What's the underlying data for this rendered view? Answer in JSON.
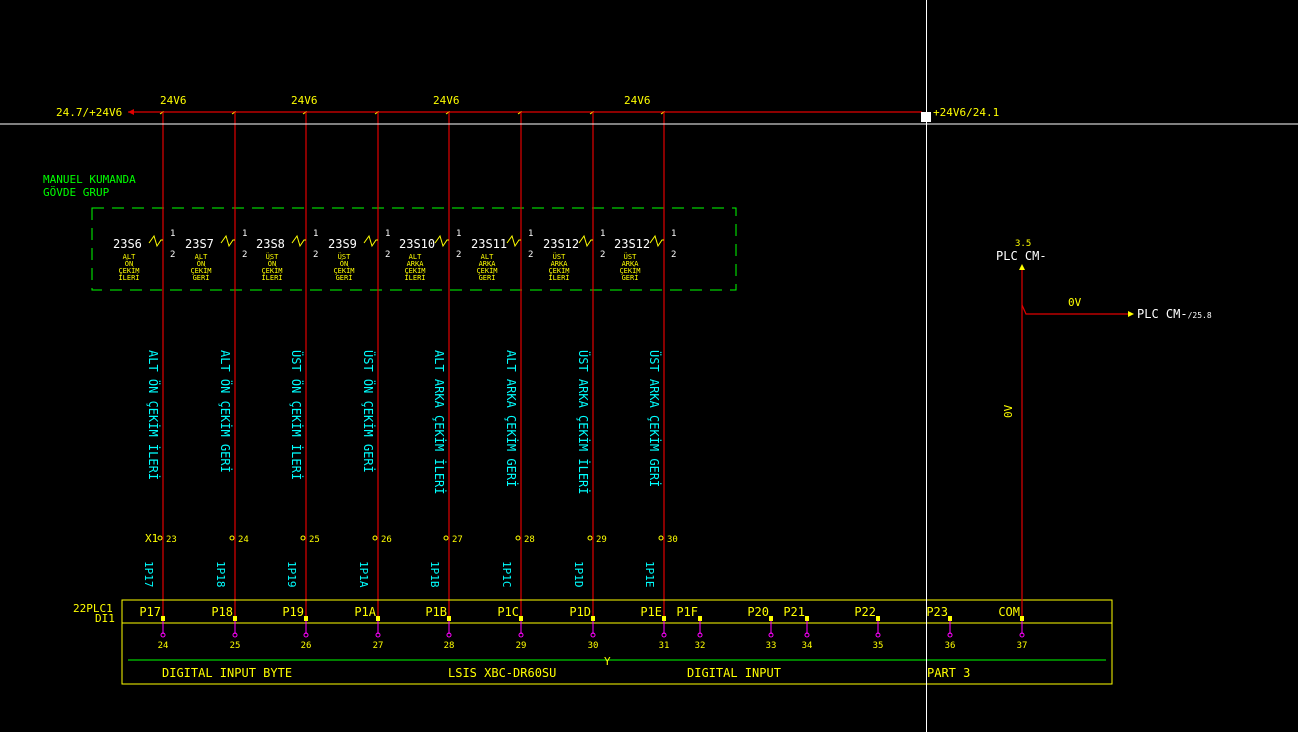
{
  "colors": {
    "background": "#000000",
    "wire": "#e00000",
    "text": "#ffffff",
    "yellow": "#ffff00",
    "green": "#00ff00",
    "cyan": "#00ffff",
    "magenta": "#ff00ff",
    "crosshair": "#ffffff"
  },
  "supply": {
    "left_label": "24.7/+24V6",
    "right_label": "+24V6/24.1",
    "bus_labels": [
      "24V6",
      "24V6",
      "24V6",
      "24V6"
    ]
  },
  "group": {
    "title_line1": "MANUEL KUMANDA",
    "title_line2": "GÖVDE GRUP"
  },
  "switches": [
    {
      "tag": "23S6",
      "pin_top": "1",
      "pin_bot": "2",
      "desc": [
        "ALT",
        "ÖN",
        "ÇEKİM",
        "İLERİ"
      ]
    },
    {
      "tag": "23S7",
      "pin_top": "1",
      "pin_bot": "2",
      "desc": [
        "ALT",
        "ÖN",
        "ÇEKİM",
        "GERİ"
      ]
    },
    {
      "tag": "23S8",
      "pin_top": "1",
      "pin_bot": "2",
      "desc": [
        "ÜST",
        "ÖN",
        "ÇEKİM",
        "İLERİ"
      ]
    },
    {
      "tag": "23S9",
      "pin_top": "1",
      "pin_bot": "2",
      "desc": [
        "ÜST",
        "ÖN",
        "ÇEKİM",
        "GERİ"
      ]
    },
    {
      "tag": "23S10",
      "pin_top": "1",
      "pin_bot": "2",
      "desc": [
        "ALT",
        "ARKA",
        "ÇEKİM",
        "İLERİ"
      ]
    },
    {
      "tag": "23S11",
      "pin_top": "1",
      "pin_bot": "2",
      "desc": [
        "ALT",
        "ARKA",
        "ÇEKİM",
        "GERİ"
      ]
    },
    {
      "tag": "23S12",
      "pin_top": "1",
      "pin_bot": "2",
      "desc": [
        "ÜST",
        "ARKA",
        "ÇEKİM",
        "İLERİ"
      ]
    },
    {
      "tag": "23S12",
      "pin_top": "1",
      "pin_bot": "2",
      "desc": [
        "ÜST",
        "ARKA",
        "ÇEKİM",
        "GERİ"
      ]
    }
  ],
  "wire_labels": [
    "ALT ÖN ÇEKİM İLERİ",
    "ALT ÖN ÇEKİM GERİ",
    "ÜST ÖN ÇEKİM İLERİ",
    "ÜST ÖN ÇEKİM GERİ",
    "ALT ARKA ÇEKİM İLERİ",
    "ALT ARKA ÇEKİM GERİ",
    "ÜST ARKA ÇEKİM İLERİ",
    "ÜST ARKA ÇEKİM GERİ"
  ],
  "terminal_strip": {
    "name": "X1",
    "terminals": [
      "23",
      "24",
      "25",
      "26",
      "27",
      "28",
      "29",
      "30"
    ]
  },
  "wire_numbers": [
    "1P17",
    "1P18",
    "1P19",
    "1P1A",
    "1P1B",
    "1P1C",
    "1P1D",
    "1P1E"
  ],
  "plc": {
    "tag_line1": "22PLC1",
    "tag_line2": "DI1",
    "inputs": [
      "P17",
      "P18",
      "P19",
      "P1A",
      "P1B",
      "P1C",
      "P1D",
      "P1E",
      "P1F",
      "P20",
      "P21",
      "P22",
      "P23",
      "COM"
    ],
    "pins": [
      "24",
      "25",
      "26",
      "27",
      "28",
      "29",
      "30",
      "31",
      "32",
      "33",
      "34",
      "35",
      "36",
      "37"
    ],
    "footer_left": "DIGITAL INPUT BYTE",
    "footer_model": "LSIS XBC-DR60SU",
    "footer_mid": "DIGITAL INPUT",
    "footer_right": "PART 3",
    "y_mark": "Y"
  },
  "plc_cm": {
    "ref": "3.5",
    "label": "PLC CM-",
    "zero_v": "0V",
    "vertical_label": "0V",
    "out_label": "PLC CM-",
    "out_ref": "/25.8"
  }
}
